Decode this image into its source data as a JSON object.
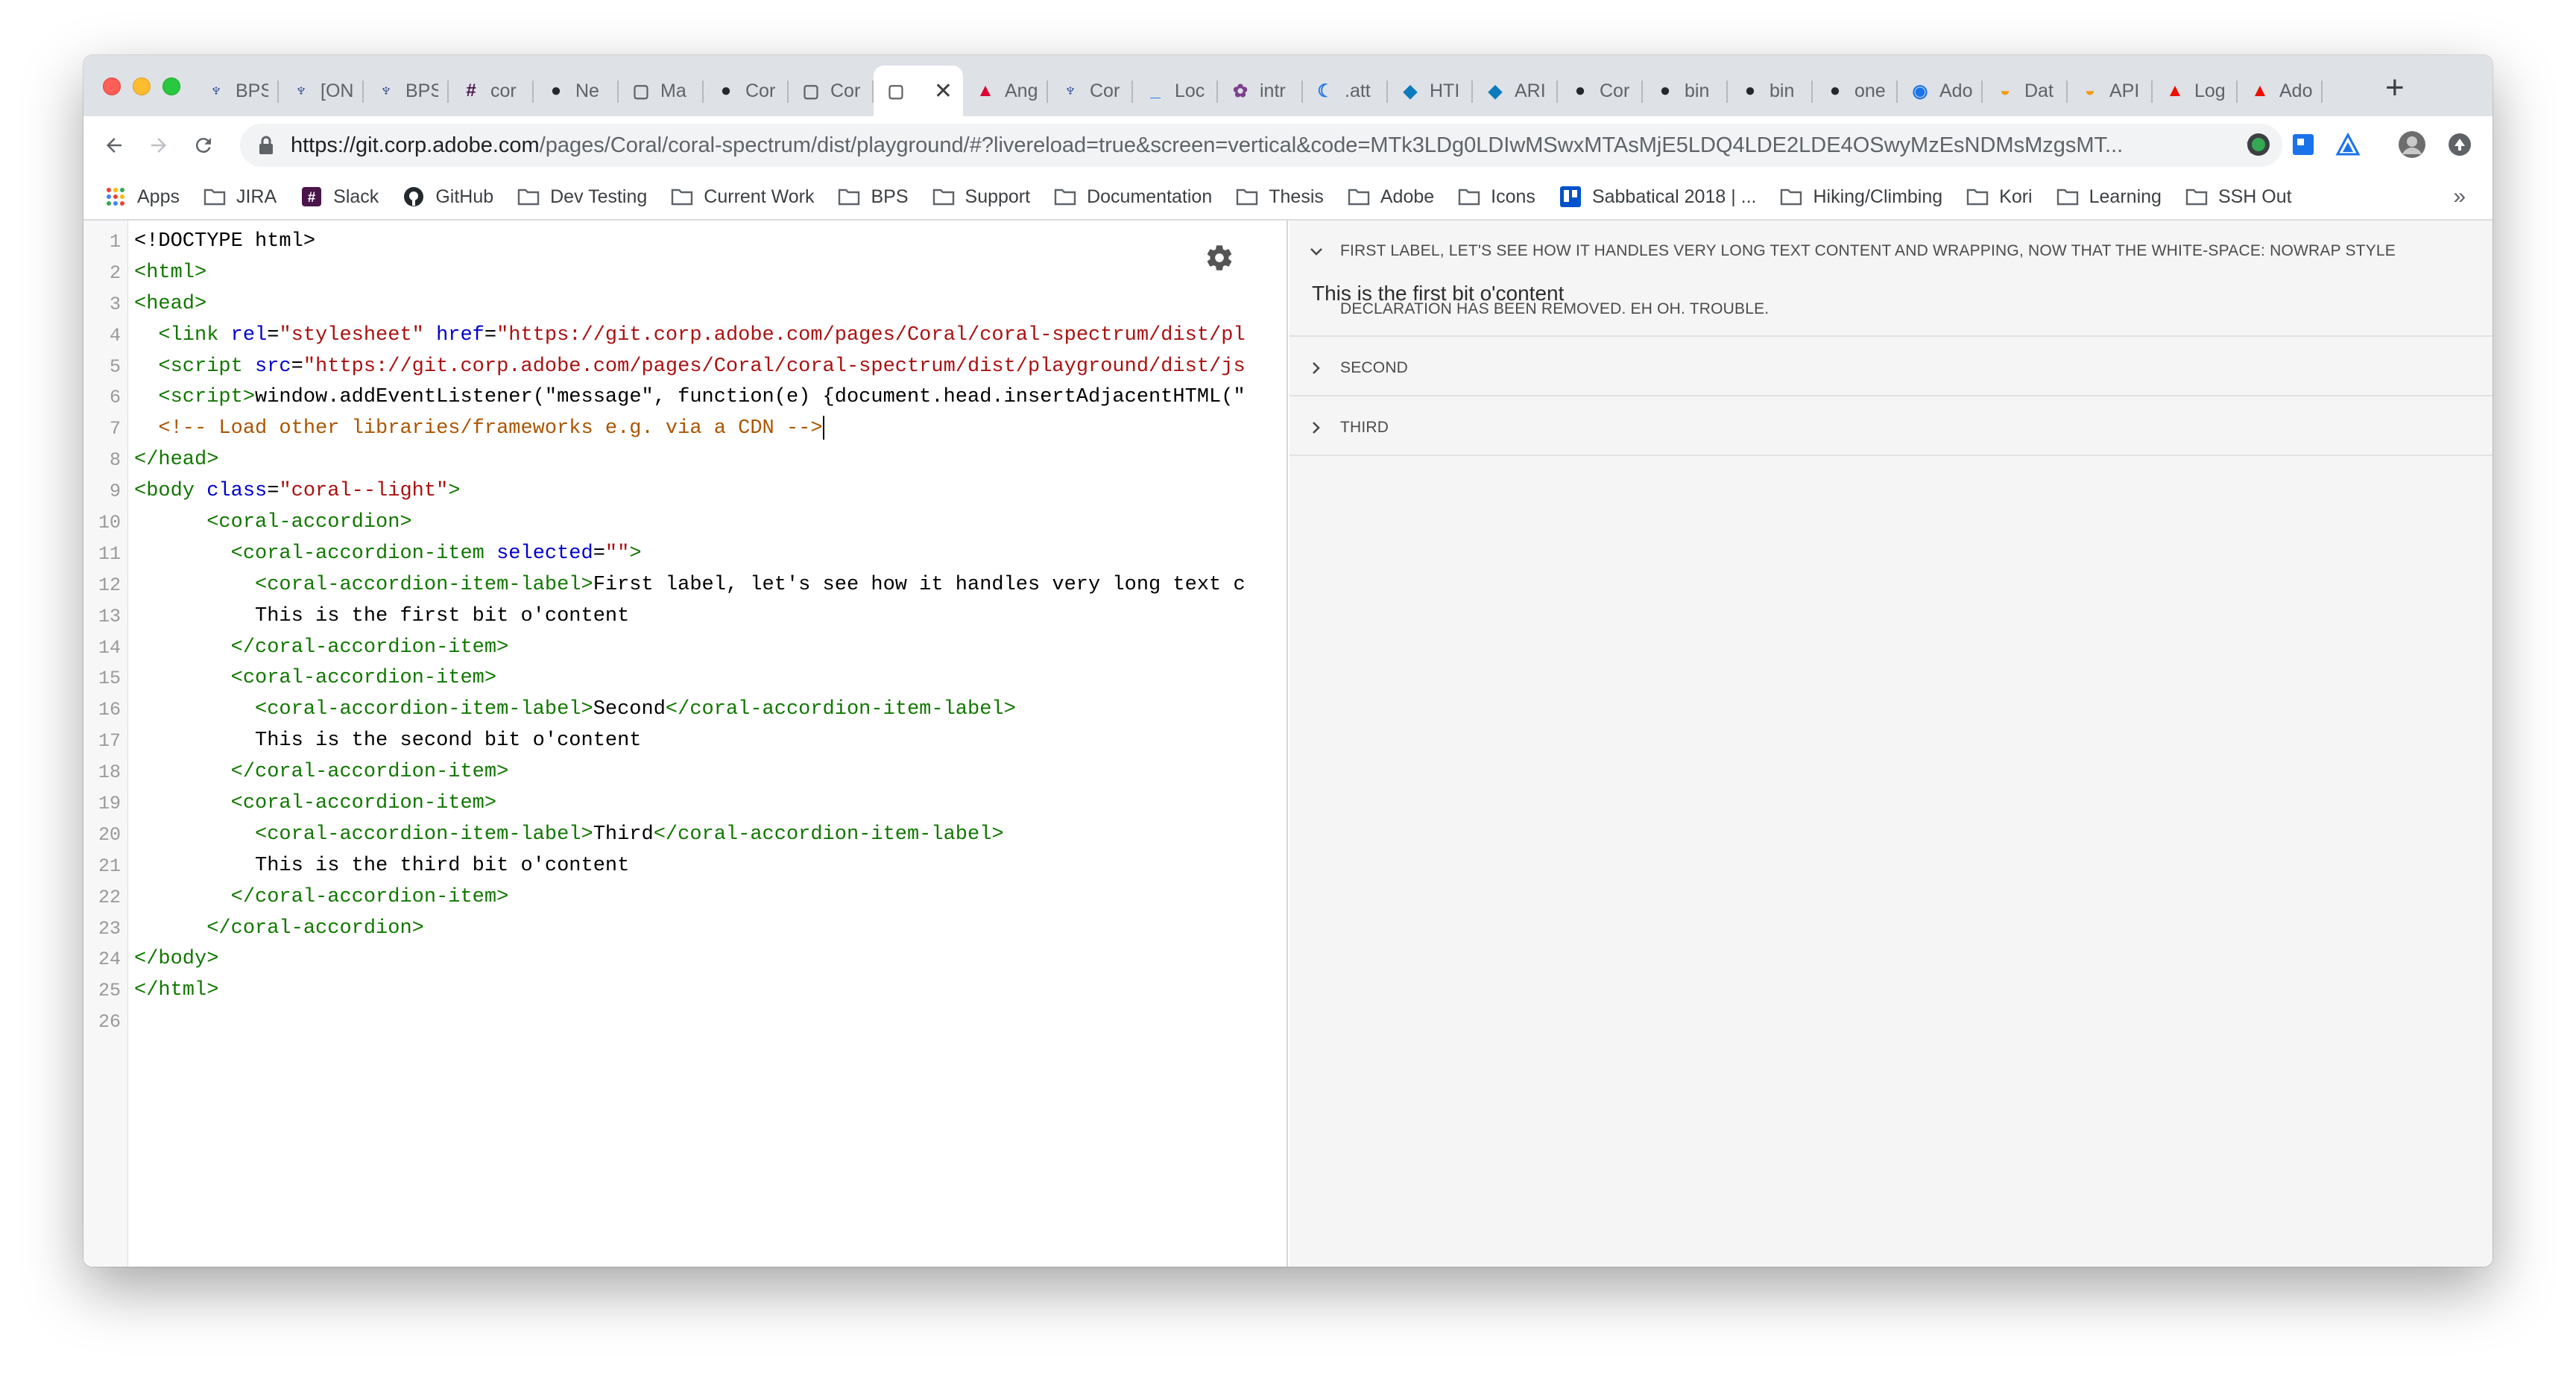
{
  "browser": {
    "tabs": [
      {
        "icon": "coral-icon",
        "title": "BPS"
      },
      {
        "icon": "coral-icon",
        "title": "[ON"
      },
      {
        "icon": "coral-icon",
        "title": "BPS"
      },
      {
        "icon": "slack-icon",
        "title": "cor"
      },
      {
        "icon": "github-icon",
        "title": "Ne"
      },
      {
        "icon": "page-icon",
        "title": "Ma"
      },
      {
        "icon": "github-icon",
        "title": "Cor"
      },
      {
        "icon": "page-icon",
        "title": "Cor"
      },
      {
        "icon": "page-icon",
        "title": ""
      },
      {
        "icon": "angular-icon",
        "title": "Ang"
      },
      {
        "icon": "coral-icon",
        "title": "Cor"
      },
      {
        "icon": "dash-icon",
        "title": "Loc"
      },
      {
        "icon": "flower-icon",
        "title": "intr"
      },
      {
        "icon": "moon-icon",
        "title": ".att"
      },
      {
        "icon": "bird-icon",
        "title": "HTI"
      },
      {
        "icon": "bird-icon",
        "title": "ARI"
      },
      {
        "icon": "github-icon",
        "title": "Cor"
      },
      {
        "icon": "github-icon",
        "title": "bin"
      },
      {
        "icon": "github-icon",
        "title": "bin"
      },
      {
        "icon": "github-icon",
        "title": "one"
      },
      {
        "icon": "circle-icon",
        "title": "Ado"
      },
      {
        "icon": "taco-icon",
        "title": "Dat"
      },
      {
        "icon": "taco-icon",
        "title": "API"
      },
      {
        "icon": "adobe-icon",
        "title": "Log"
      },
      {
        "icon": "adobe-icon",
        "title": "Ado"
      }
    ],
    "active_tab_index": 8,
    "close_glyph": "✕",
    "new_tab_glyph": "+",
    "url_host": "https://git.corp.adobe.com",
    "url_rest": "/pages/Coral/coral-spectrum/dist/playground/#?livereload=true&screen=vertical&code=MTk3LDg0LDIwMSwxMTAsMjE5LDQ4LDE2LDE4OSwyMzEsNDMsMzgsMT...",
    "bookmarks": [
      {
        "icon": "apps-icon",
        "label": "Apps"
      },
      {
        "icon": "folder-icon",
        "label": "JIRA"
      },
      {
        "icon": "slack-icon",
        "label": "Slack"
      },
      {
        "icon": "github-icon",
        "label": "GitHub"
      },
      {
        "icon": "folder-icon",
        "label": "Dev Testing"
      },
      {
        "icon": "folder-icon",
        "label": "Current Work"
      },
      {
        "icon": "folder-icon",
        "label": "BPS"
      },
      {
        "icon": "folder-icon",
        "label": "Support"
      },
      {
        "icon": "folder-icon",
        "label": "Documentation"
      },
      {
        "icon": "folder-icon",
        "label": "Thesis"
      },
      {
        "icon": "folder-icon",
        "label": "Adobe"
      },
      {
        "icon": "folder-icon",
        "label": "Icons"
      },
      {
        "icon": "trello-icon",
        "label": "Sabbatical 2018 | ..."
      },
      {
        "icon": "folder-icon",
        "label": "Hiking/Climbing"
      },
      {
        "icon": "folder-icon",
        "label": "Kori"
      },
      {
        "icon": "folder-icon",
        "label": "Learning"
      },
      {
        "icon": "folder-icon",
        "label": "SSH Out"
      }
    ],
    "bookmarks_more": "»"
  },
  "editor": {
    "lines": [
      [
        [
          "t",
          "<!DOCTYPE html>"
        ]
      ],
      [
        [
          "g",
          "<html>"
        ]
      ],
      [
        [
          "g",
          "<head>"
        ]
      ],
      [
        [
          "g",
          "  <link "
        ],
        [
          "b",
          "rel"
        ],
        [
          "t",
          "="
        ],
        [
          "r",
          "\"stylesheet\""
        ],
        [
          "t",
          " "
        ],
        [
          "b",
          "href"
        ],
        [
          "t",
          "="
        ],
        [
          "r",
          "\"https://git.corp.adobe.com/pages/Coral/coral-spectrum/dist/pl"
        ]
      ],
      [
        [
          "g",
          "  <script "
        ],
        [
          "b",
          "src"
        ],
        [
          "t",
          "="
        ],
        [
          "r",
          "\"https://git.corp.adobe.com/pages/Coral/coral-spectrum/dist/playground/dist/js"
        ]
      ],
      [
        [
          "g",
          "  <script>"
        ],
        [
          "t",
          "window.addEventListener(\"message\", function(e) {document.head.insertAdjacentHTML(\""
        ]
      ],
      [
        [
          "o",
          "  <!-- Load other libraries/frameworks e.g. via a CDN -->"
        ]
      ],
      [
        [
          "g",
          "</head>"
        ]
      ],
      [
        [
          "g",
          "<body "
        ],
        [
          "b",
          "class"
        ],
        [
          "t",
          "="
        ],
        [
          "r",
          "\"coral--light\""
        ],
        [
          "g",
          ">"
        ]
      ],
      [
        [
          "g",
          "      <coral-accordion>"
        ]
      ],
      [
        [
          "g",
          "        <coral-accordion-item "
        ],
        [
          "b",
          "selected"
        ],
        [
          "t",
          "="
        ],
        [
          "r",
          "\"\""
        ],
        [
          "g",
          ">"
        ]
      ],
      [
        [
          "g",
          "          <coral-accordion-item-label>"
        ],
        [
          "t",
          "First label, let's see how it handles very long text c"
        ]
      ],
      [
        [
          "t",
          "          This is the first bit o'content"
        ]
      ],
      [
        [
          "g",
          "        </coral-accordion-item>"
        ]
      ],
      [
        [
          "g",
          "        <coral-accordion-item>"
        ]
      ],
      [
        [
          "g",
          "          <coral-accordion-item-label>"
        ],
        [
          "t",
          "Second"
        ],
        [
          "g",
          "</coral-accordion-item-label>"
        ]
      ],
      [
        [
          "t",
          "          This is the second bit o'content"
        ]
      ],
      [
        [
          "g",
          "        </coral-accordion-item>"
        ]
      ],
      [
        [
          "g",
          "        <coral-accordion-item>"
        ]
      ],
      [
        [
          "g",
          "          <coral-accordion-item-label>"
        ],
        [
          "t",
          "Third"
        ],
        [
          "g",
          "</coral-accordion-item-label>"
        ]
      ],
      [
        [
          "t",
          "          This is the third bit o'content"
        ]
      ],
      [
        [
          "g",
          "        </coral-accordion-item>"
        ]
      ],
      [
        [
          "g",
          "      </coral-accordion>"
        ]
      ],
      [
        [
          "g",
          "</body>"
        ]
      ],
      [
        [
          "g",
          "</html>"
        ]
      ],
      []
    ],
    "cursor_line": 7,
    "colors": {
      "t": "#000000",
      "g": "#117700",
      "b": "#0000cc",
      "r": "#aa1111",
      "o": "#aa5500"
    }
  },
  "preview": {
    "items": [
      {
        "label": "First label, let's see how it handles very long text content and wrapping, now that the white-space: nowrap style declaration has been removed. Eh oh. Trouble.",
        "content": "This is the first bit o'content",
        "expanded": true
      },
      {
        "label": "Second",
        "content": "This is the second bit o'content",
        "expanded": false
      },
      {
        "label": "Third",
        "content": "This is the third bit o'content",
        "expanded": false
      }
    ]
  }
}
